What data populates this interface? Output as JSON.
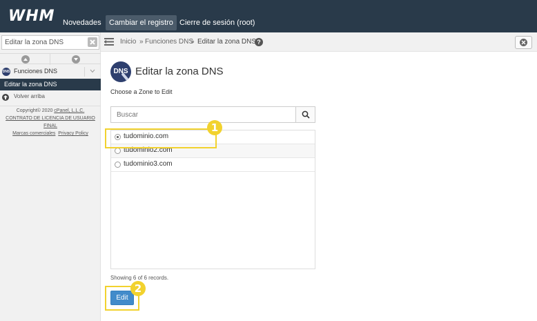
{
  "header": {
    "logo": "WHM",
    "nav": [
      "Novedades",
      "Cambiar el registro",
      "Cierre de sesión (root)"
    ]
  },
  "sidebar": {
    "search_value": "Editar la zona DNS",
    "category": "Funciones DNS",
    "active_item": "Editar la zona DNS",
    "back_to_top": "Volver arriba",
    "footer": {
      "copyright_prefix": "Copyright© 2020 ",
      "company": "cPanel, L.L.C.",
      "license": "CONTRATO DE LICENCIA DE USUARIO FINAL",
      "trademarks": "Marcas comerciales",
      "privacy": "Privacy Policy"
    }
  },
  "breadcrumb": {
    "home": "Inicio",
    "separator": "»",
    "section": "Funciones DNS",
    "current": "Editar la zona DNS"
  },
  "main": {
    "logo_text": "DNS",
    "title": "Editar la zona DNS",
    "subtitle": "Choose a Zone to Edit",
    "search_placeholder": "Buscar",
    "zones": [
      "tudominio.com",
      "tudominio2.com",
      "tudominio3.com"
    ],
    "selected_zone": "tudominio.com",
    "showing": "Showing 6 of 6 records.",
    "edit_label": "Edit"
  },
  "annotations": {
    "badge1": "1",
    "badge2": "2",
    "color": "#f2d22e"
  },
  "colors": {
    "topbar": "#293a4a",
    "primary_button": "#428bca"
  }
}
